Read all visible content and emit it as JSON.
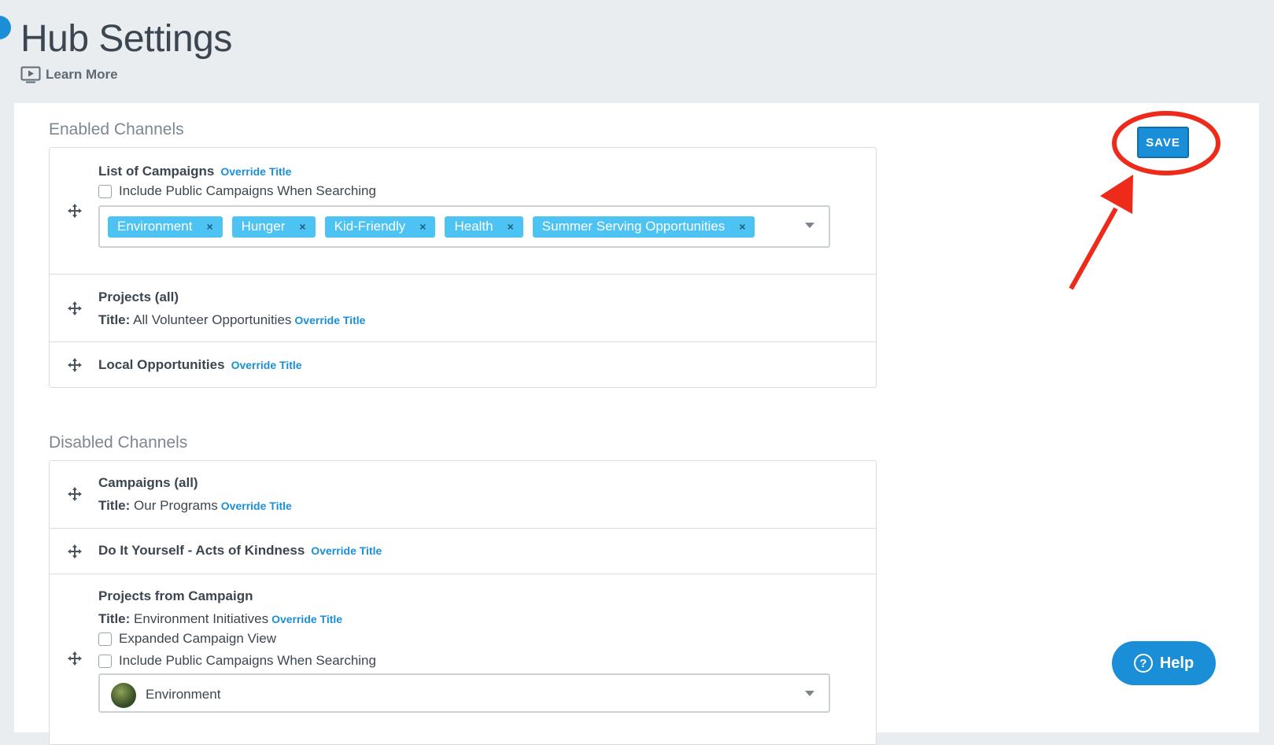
{
  "header": {
    "title": "Hub Settings",
    "learn_more": "Learn More"
  },
  "toolbar": {
    "save_label": "SAVE"
  },
  "enabled": {
    "section_title": "Enabled Channels",
    "override_label": "Override Title",
    "list_of_campaigns": {
      "name": "List of Campaigns",
      "include_public_label": "Include Public Campaigns When Searching",
      "tags": [
        "Environment",
        "Hunger",
        "Kid-Friendly",
        "Health",
        "Summer Serving Opportunities"
      ],
      "tag_remove": "×"
    },
    "projects_all": {
      "name": "Projects (all)",
      "title_prefix": "Title:",
      "title_value": "All Volunteer Opportunities"
    },
    "local_opportunities": {
      "name": "Local Opportunities"
    }
  },
  "disabled": {
    "section_title": "Disabled Channels",
    "campaigns_all": {
      "name": "Campaigns (all)",
      "title_prefix": "Title:",
      "title_value": "Our Programs"
    },
    "diy": {
      "name": "Do It Yourself - Acts of Kindness"
    },
    "projects_from_campaign": {
      "name": "Projects from Campaign",
      "title_prefix": "Title:",
      "title_value": "Environment Initiatives",
      "expanded_label": "Expanded Campaign View",
      "include_public_label": "Include Public Campaigns When Searching",
      "selected_campaign": "Environment"
    }
  },
  "help": {
    "label": "Help",
    "icon_glyph": "?"
  },
  "colors": {
    "accent": "#1a8fd8",
    "tag": "#4dc3f4",
    "annotation": "#ee2a1b"
  }
}
